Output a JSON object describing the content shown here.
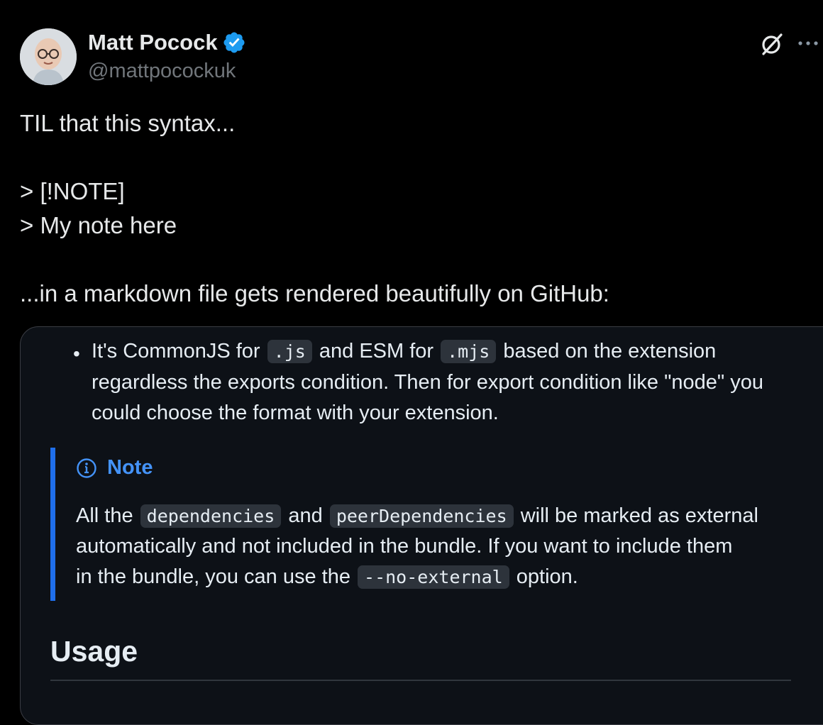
{
  "author": {
    "name": "Matt Pocock",
    "handle": "@mattpocockuk",
    "verified": true
  },
  "icons": {
    "verified": "verified-badge-icon",
    "grok": "grok-icon",
    "more": "more-icon",
    "note": "info-circle-icon"
  },
  "colors": {
    "background": "#000000",
    "text": "#e7e9ea",
    "handle": "#71767b",
    "verified": "#1d9bf0",
    "media_bg": "#0d1117",
    "note_accent": "#1f6feb",
    "note_title": "#4493f8"
  },
  "tweet": {
    "text": "TIL that this syntax...\n\n> [!NOTE]\n> My note here\n\n...in a markdown file gets rendered beautifully on GitHub:"
  },
  "media": {
    "bullet": {
      "line1_part1": "It's CommonJS for",
      "code1": ".js",
      "line1_part2": "and ESM for",
      "code2": ".mjs",
      "line1_part3": "based on the extension",
      "line2": "regardless the exports condition. Then for export condition like \"node\" you",
      "line3": "could choose the format with your extension."
    },
    "note": {
      "title": "Note",
      "line1_part1": "All the",
      "code1": "dependencies",
      "line1_part2": "and",
      "code2": "peerDependencies",
      "line1_part3": "will be marked as external",
      "line2": "automatically and not included in the bundle. If you want to include them",
      "line3_part1": "in the bundle, you can use the",
      "code3": "--no-external",
      "line3_part2": "option."
    },
    "heading": "Usage"
  }
}
